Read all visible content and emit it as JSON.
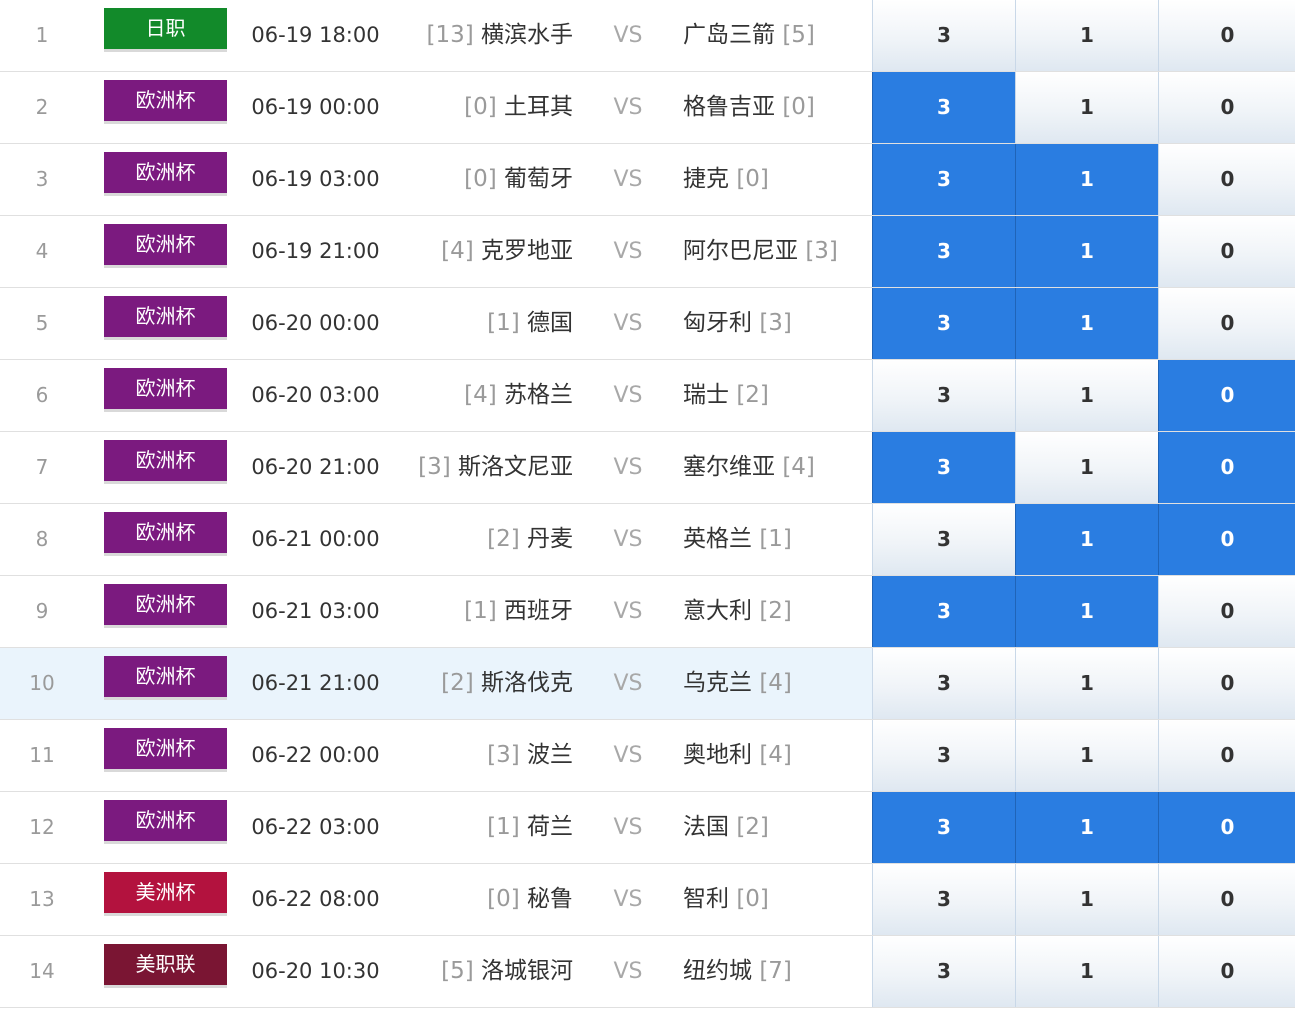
{
  "colors": {
    "selected_blue": "#2a7de1",
    "jzhi": "#128a2a",
    "euro": "#7b1a7f",
    "copa": "#b3123e",
    "mls": "#7a1533"
  },
  "matches": [
    {
      "no": "1",
      "league": "日职",
      "league_color": "#128a2a",
      "time": "06-19 18:00",
      "home_rank": "[13]",
      "home": "横滨水手",
      "vs": "VS",
      "away": "广岛三箭",
      "away_rank": "[5]",
      "opt3": "3",
      "opt1": "1",
      "opt0": "0",
      "sel": [
        false,
        false,
        false
      ],
      "highlight": false
    },
    {
      "no": "2",
      "league": "欧洲杯",
      "league_color": "#7b1a7f",
      "time": "06-19 00:00",
      "home_rank": "[0]",
      "home": "土耳其",
      "vs": "VS",
      "away": "格鲁吉亚",
      "away_rank": "[0]",
      "opt3": "3",
      "opt1": "1",
      "opt0": "0",
      "sel": [
        true,
        false,
        false
      ],
      "highlight": false
    },
    {
      "no": "3",
      "league": "欧洲杯",
      "league_color": "#7b1a7f",
      "time": "06-19 03:00",
      "home_rank": "[0]",
      "home": "葡萄牙",
      "vs": "VS",
      "away": "捷克",
      "away_rank": "[0]",
      "opt3": "3",
      "opt1": "1",
      "opt0": "0",
      "sel": [
        true,
        true,
        false
      ],
      "highlight": false
    },
    {
      "no": "4",
      "league": "欧洲杯",
      "league_color": "#7b1a7f",
      "time": "06-19 21:00",
      "home_rank": "[4]",
      "home": "克罗地亚",
      "vs": "VS",
      "away": "阿尔巴尼亚",
      "away_rank": "[3]",
      "opt3": "3",
      "opt1": "1",
      "opt0": "0",
      "sel": [
        true,
        true,
        false
      ],
      "highlight": false
    },
    {
      "no": "5",
      "league": "欧洲杯",
      "league_color": "#7b1a7f",
      "time": "06-20 00:00",
      "home_rank": "[1]",
      "home": "德国",
      "vs": "VS",
      "away": "匈牙利",
      "away_rank": "[3]",
      "opt3": "3",
      "opt1": "1",
      "opt0": "0",
      "sel": [
        true,
        true,
        false
      ],
      "highlight": false
    },
    {
      "no": "6",
      "league": "欧洲杯",
      "league_color": "#7b1a7f",
      "time": "06-20 03:00",
      "home_rank": "[4]",
      "home": "苏格兰",
      "vs": "VS",
      "away": "瑞士",
      "away_rank": "[2]",
      "opt3": "3",
      "opt1": "1",
      "opt0": "0",
      "sel": [
        false,
        false,
        true
      ],
      "highlight": false
    },
    {
      "no": "7",
      "league": "欧洲杯",
      "league_color": "#7b1a7f",
      "time": "06-20 21:00",
      "home_rank": "[3]",
      "home": "斯洛文尼亚",
      "vs": "VS",
      "away": "塞尔维亚",
      "away_rank": "[4]",
      "opt3": "3",
      "opt1": "1",
      "opt0": "0",
      "sel": [
        true,
        false,
        true
      ],
      "highlight": false
    },
    {
      "no": "8",
      "league": "欧洲杯",
      "league_color": "#7b1a7f",
      "time": "06-21 00:00",
      "home_rank": "[2]",
      "home": "丹麦",
      "vs": "VS",
      "away": "英格兰",
      "away_rank": "[1]",
      "opt3": "3",
      "opt1": "1",
      "opt0": "0",
      "sel": [
        false,
        true,
        true
      ],
      "highlight": false
    },
    {
      "no": "9",
      "league": "欧洲杯",
      "league_color": "#7b1a7f",
      "time": "06-21 03:00",
      "home_rank": "[1]",
      "home": "西班牙",
      "vs": "VS",
      "away": "意大利",
      "away_rank": "[2]",
      "opt3": "3",
      "opt1": "1",
      "opt0": "0",
      "sel": [
        true,
        true,
        false
      ],
      "highlight": false
    },
    {
      "no": "10",
      "league": "欧洲杯",
      "league_color": "#7b1a7f",
      "time": "06-21 21:00",
      "home_rank": "[2]",
      "home": "斯洛伐克",
      "vs": "VS",
      "away": "乌克兰",
      "away_rank": "[4]",
      "opt3": "3",
      "opt1": "1",
      "opt0": "0",
      "sel": [
        false,
        false,
        false
      ],
      "highlight": true
    },
    {
      "no": "11",
      "league": "欧洲杯",
      "league_color": "#7b1a7f",
      "time": "06-22 00:00",
      "home_rank": "[3]",
      "home": "波兰",
      "vs": "VS",
      "away": "奥地利",
      "away_rank": "[4]",
      "opt3": "3",
      "opt1": "1",
      "opt0": "0",
      "sel": [
        false,
        false,
        false
      ],
      "highlight": false
    },
    {
      "no": "12",
      "league": "欧洲杯",
      "league_color": "#7b1a7f",
      "time": "06-22 03:00",
      "home_rank": "[1]",
      "home": "荷兰",
      "vs": "VS",
      "away": "法国",
      "away_rank": "[2]",
      "opt3": "3",
      "opt1": "1",
      "opt0": "0",
      "sel": [
        true,
        true,
        true
      ],
      "highlight": false
    },
    {
      "no": "13",
      "league": "美洲杯",
      "league_color": "#b3123e",
      "time": "06-22 08:00",
      "home_rank": "[0]",
      "home": "秘鲁",
      "vs": "VS",
      "away": "智利",
      "away_rank": "[0]",
      "opt3": "3",
      "opt1": "1",
      "opt0": "0",
      "sel": [
        false,
        false,
        false
      ],
      "highlight": false
    },
    {
      "no": "14",
      "league": "美职联",
      "league_color": "#7a1533",
      "time": "06-20 10:30",
      "home_rank": "[5]",
      "home": "洛城银河",
      "vs": "VS",
      "away": "纽约城",
      "away_rank": "[7]",
      "opt3": "3",
      "opt1": "1",
      "opt0": "0",
      "sel": [
        false,
        false,
        false
      ],
      "highlight": false
    }
  ]
}
